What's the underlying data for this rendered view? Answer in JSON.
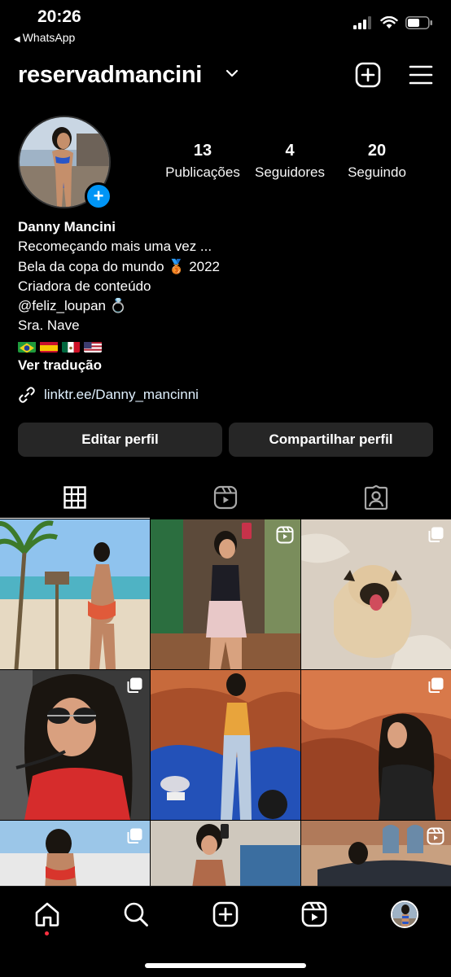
{
  "status_bar": {
    "time": "20:26",
    "back_app": "WhatsApp",
    "icons": [
      "cellular-signal-icon",
      "wifi-icon",
      "battery-icon"
    ]
  },
  "header": {
    "username": "reservadmancini",
    "icons": [
      "chevron-down-icon",
      "new-post-icon",
      "menu-icon"
    ]
  },
  "profile": {
    "stats": [
      {
        "value": "13",
        "label": "Publicações"
      },
      {
        "value": "4",
        "label": "Seguidores"
      },
      {
        "value": "20",
        "label": "Seguindo"
      }
    ],
    "name": "Danny Mancini",
    "bio_lines": [
      "Recomeçando mais uma vez ...",
      "Bela da copa do mundo 🥉 2022",
      "Criadora de conteúdo",
      "@feliz_loupan 💍",
      "Sra. Nave"
    ],
    "flags": [
      "brazil-flag",
      "spain-flag",
      "mexico-flag",
      "usa-flag"
    ],
    "see_translation": "Ver tradução",
    "link": "linktr.ee/Danny_mancinni"
  },
  "actions": {
    "edit_profile": "Editar perfil",
    "share_profile": "Compartilhar perfil"
  },
  "tabs": [
    "grid-icon",
    "reels-icon",
    "tagged-icon"
  ],
  "grid_posts": [
    {
      "subject": "beach-photo",
      "badge": ""
    },
    {
      "subject": "mirror-selfie",
      "badge": "reel"
    },
    {
      "subject": "pug-photo",
      "badge": "carousel"
    },
    {
      "subject": "helicopter-selfie",
      "badge": "carousel"
    },
    {
      "subject": "car-photo",
      "badge": ""
    },
    {
      "subject": "canyon-photo",
      "badge": "carousel"
    },
    {
      "subject": "pool-photo",
      "badge": "carousel"
    },
    {
      "subject": "mirror-selfie-2",
      "badge": ""
    },
    {
      "subject": "car-street-photo",
      "badge": "reel"
    }
  ],
  "bottom_nav": [
    "home-icon",
    "search-icon",
    "create-icon",
    "reels-icon",
    "profile-avatar"
  ]
}
